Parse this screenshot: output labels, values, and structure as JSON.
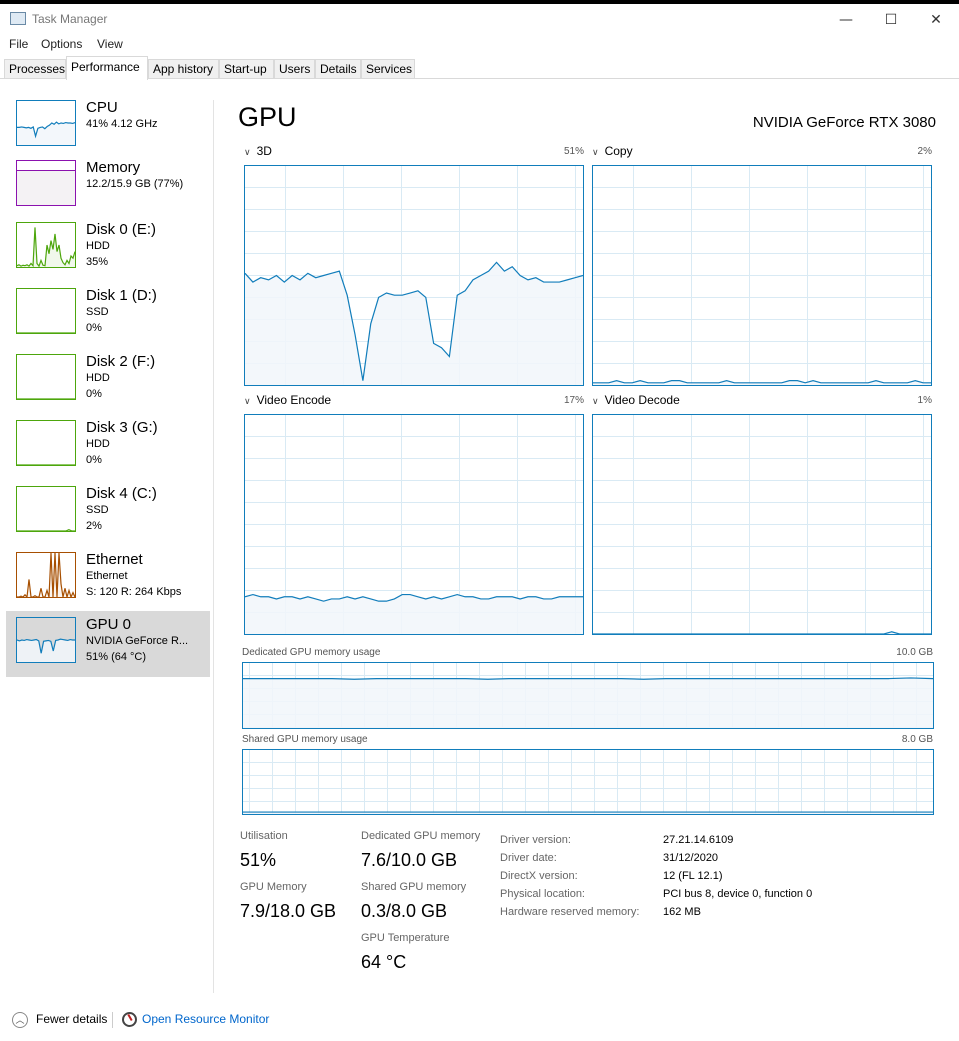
{
  "window": {
    "title": "Task Manager",
    "minimize": "—",
    "maximize": "☐",
    "close": "✕"
  },
  "menu": [
    "File",
    "Options",
    "View"
  ],
  "tabs": [
    "Processes",
    "Performance",
    "App history",
    "Start-up",
    "Users",
    "Details",
    "Services"
  ],
  "sidebar": [
    {
      "name": "CPU",
      "l2": "41% 4.12 GHz",
      "l3": "",
      "color": "#117dbb",
      "fill": "#f1f6fa",
      "values": [
        40,
        40,
        41,
        40,
        39,
        40,
        38,
        41,
        20,
        38,
        40,
        41,
        37,
        42,
        45,
        50,
        47,
        52,
        48,
        50,
        49,
        51,
        50,
        50,
        49,
        51
      ]
    },
    {
      "name": "Memory",
      "l2": "12.2/15.9 GB (77%)",
      "l3": "",
      "color": "#8b12ae",
      "fill": "#f4f2f4",
      "values": [
        77,
        77,
        77,
        77,
        77,
        77,
        77,
        77,
        77,
        77
      ]
    },
    {
      "name": "Disk 0 (E:)",
      "l2": "HDD",
      "l3": "35%",
      "color": "#4da60c",
      "fill": "#eff7e9",
      "values": [
        3,
        5,
        2,
        4,
        3,
        5,
        2,
        8,
        3,
        90,
        8,
        2,
        15,
        4,
        3,
        50,
        30,
        60,
        40,
        75,
        35,
        50,
        20,
        10,
        5,
        15,
        8,
        25,
        20,
        35
      ]
    },
    {
      "name": "Disk 1 (D:)",
      "l2": "SSD",
      "l3": "0%",
      "color": "#4da60c",
      "fill": "#eff7e9",
      "values": [
        0,
        0
      ]
    },
    {
      "name": "Disk 2 (F:)",
      "l2": "HDD",
      "l3": "0%",
      "color": "#4da60c",
      "fill": "#eff7e9",
      "values": [
        0,
        0
      ]
    },
    {
      "name": "Disk 3 (G:)",
      "l2": "HDD",
      "l3": "0%",
      "color": "#4da60c",
      "fill": "#eff7e9",
      "values": [
        0,
        0
      ]
    },
    {
      "name": "Disk 4 (C:)",
      "l2": "SSD",
      "l3": "2%",
      "color": "#4da60c",
      "fill": "#eff7e9",
      "values": [
        0,
        0,
        0,
        0,
        0,
        0,
        0,
        0,
        0,
        0,
        0,
        0,
        0,
        0,
        0,
        0,
        0,
        3,
        0,
        0
      ]
    },
    {
      "name": "Ethernet",
      "l2": "Ethernet",
      "l3": "S: 120 R: 264 Kbps",
      "color": "#a74f01",
      "fill": "#fcf3eb",
      "values": [
        0,
        0,
        2,
        0,
        5,
        0,
        40,
        0,
        0,
        3,
        0,
        0,
        20,
        0,
        0,
        15,
        0,
        100,
        0,
        100,
        0,
        100,
        30,
        0,
        20,
        0,
        15,
        0,
        10,
        0
      ]
    },
    {
      "name": "GPU 0",
      "l2": "NVIDIA GeForce R...",
      "l3": "51% (64 °C)",
      "color": "#117dbb",
      "fill": "#f1f6fa",
      "values": [
        50,
        48,
        50,
        49,
        51,
        50,
        49,
        50,
        51,
        48,
        20,
        47,
        48,
        49,
        47,
        25,
        49,
        50,
        52,
        51,
        50,
        49,
        51,
        50,
        50
      ]
    }
  ],
  "main": {
    "title": "GPU",
    "model": "NVIDIA GeForce RTX 3080"
  },
  "graphs": [
    {
      "label": "3D",
      "pct": "51%",
      "values": [
        51,
        47,
        49,
        48,
        50,
        47,
        50,
        48,
        51,
        49,
        50,
        51,
        52,
        41,
        23,
        2,
        28,
        40,
        42,
        41,
        41,
        42,
        43,
        40,
        19,
        17,
        13,
        41,
        43,
        48,
        50,
        52,
        56,
        52,
        54,
        50,
        48,
        49,
        47,
        47,
        47,
        48,
        49,
        50
      ]
    },
    {
      "label": "Copy",
      "pct": "2%",
      "values": [
        1,
        1,
        1,
        2,
        1,
        1,
        2,
        1,
        1,
        1,
        2,
        2,
        1,
        1,
        1,
        1,
        1,
        2,
        1,
        1,
        1,
        1,
        1,
        1,
        1,
        2,
        2,
        1,
        2,
        1,
        1,
        1,
        1,
        1,
        1,
        1,
        2,
        1,
        1,
        1,
        1,
        2,
        1,
        1
      ]
    },
    {
      "label": "Video Encode",
      "pct": "17%",
      "values": [
        17,
        18,
        17,
        17,
        16,
        17,
        17,
        16,
        17,
        16,
        15,
        16,
        16,
        17,
        16,
        17,
        16,
        15,
        15,
        16,
        18,
        18,
        17,
        16,
        17,
        16,
        17,
        18,
        17,
        17,
        16,
        16,
        17,
        17,
        17,
        16,
        17,
        17,
        16,
        16,
        17,
        17,
        17,
        17
      ]
    },
    {
      "label": "Video Decode",
      "pct": "1%",
      "values": [
        0,
        0,
        0,
        0,
        0,
        0,
        0,
        0,
        0,
        0,
        0,
        0,
        0,
        0,
        0,
        0,
        0,
        0,
        0,
        0,
        0,
        0,
        0,
        0,
        0,
        0,
        0,
        0,
        0,
        0,
        0,
        0,
        0,
        0,
        0,
        0,
        0,
        0,
        1,
        0,
        0,
        0,
        0,
        0
      ]
    }
  ],
  "memory": [
    {
      "label": "Dedicated GPU memory usage",
      "max": "10.0 GB",
      "values": [
        76,
        76,
        76,
        76,
        76,
        75,
        76,
        76,
        76,
        76,
        76,
        75,
        76,
        76,
        76,
        76,
        76,
        76,
        75,
        76,
        76,
        76,
        76,
        76,
        76,
        76,
        76,
        76,
        76,
        76,
        77,
        76
      ]
    },
    {
      "label": "Shared GPU memory usage",
      "max": "8.0 GB",
      "values": [
        3,
        3,
        3,
        3,
        3,
        3,
        3,
        3,
        3,
        3,
        3,
        3,
        3,
        3,
        3,
        3,
        3,
        3,
        3,
        3,
        3,
        3,
        3,
        3,
        3,
        3,
        3,
        3,
        3,
        3,
        3,
        3
      ]
    }
  ],
  "stats": {
    "utilisation_label": "Utilisation",
    "utilisation": "51%",
    "gpu_memory_label": "GPU Memory",
    "gpu_memory": "7.9/18.0 GB",
    "dedicated_label": "Dedicated GPU memory",
    "dedicated": "7.6/10.0 GB",
    "shared_label": "Shared GPU memory",
    "shared": "0.3/8.0 GB",
    "temp_label": "GPU Temperature",
    "temp": "64 °C"
  },
  "properties": [
    {
      "key": "Driver version:",
      "value": "27.21.14.6109"
    },
    {
      "key": "Driver date:",
      "value": "31/12/2020"
    },
    {
      "key": "DirectX version:",
      "value": "12 (FL 12.1)"
    },
    {
      "key": "Physical location:",
      "value": "PCI bus 8, device 0, function 0"
    },
    {
      "key": "Hardware reserved memory:",
      "value": "162 MB"
    }
  ],
  "footer": {
    "fewer": "Fewer details",
    "resmon": "Open Resource Monitor"
  }
}
